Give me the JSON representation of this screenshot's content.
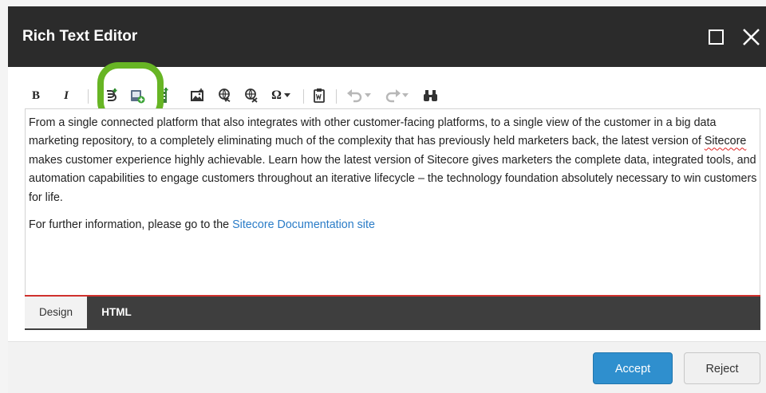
{
  "window": {
    "title": "Rich Text Editor"
  },
  "toolbar": {
    "bold_label": "B",
    "italic_label": "I",
    "symbol_label": "Ω",
    "buttons": [
      "bold",
      "italic",
      "insert-link",
      "insert-media",
      "insert-sitecore-link",
      "insert-image",
      "insert-hyperlink",
      "remove-link",
      "insert-symbol",
      "paste-from-word",
      "undo",
      "redo",
      "find-replace"
    ]
  },
  "content": {
    "paragraph1_before_spell": "From a single connected platform that also integrates with other customer-facing platforms, to a single view of the customer in a big data marketing repository, to a completely eliminating much of the complexity that has previously held marketers back, the latest version of ",
    "spell_word": "Sitecore",
    "paragraph1_after_spell": " makes customer experience highly achievable. Learn how the latest version of Sitecore gives marketers the complete data, integrated tools, and automation capabilities to engage customers throughout an iterative lifecycle – the technology foundation absolutely necessary to win customers for life.",
    "paragraph2_text": "For further information, please go to the ",
    "paragraph2_link": "Sitecore Documentation site"
  },
  "mode_tabs": {
    "design": "Design",
    "html": "HTML"
  },
  "footer": {
    "accept": "Accept",
    "reject": "Reject"
  },
  "colors": {
    "titlebar": "#2b2b2b",
    "accent_green": "#67b524",
    "accept_blue": "#2f8fce",
    "link": "#2a7cc7",
    "mode_bar_border": "#d0312d"
  }
}
